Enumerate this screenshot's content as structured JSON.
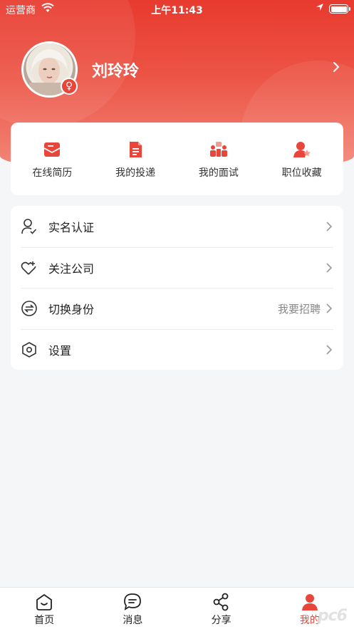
{
  "status_bar": {
    "carrier": "运营商",
    "time": "上午11:43"
  },
  "profile": {
    "name": "刘玲玲",
    "gender_symbol": "♀"
  },
  "quick_actions": [
    {
      "label": "在线简历",
      "icon": "resume-envelope-icon"
    },
    {
      "label": "我的投递",
      "icon": "document-icon"
    },
    {
      "label": "我的面试",
      "icon": "interview-icon"
    },
    {
      "label": "职位收藏",
      "icon": "favorite-job-icon"
    }
  ],
  "menu": [
    {
      "label": "实名认证",
      "icon": "user-verify-icon",
      "extra": ""
    },
    {
      "label": "关注公司",
      "icon": "heart-plus-icon",
      "extra": ""
    },
    {
      "label": "切换身份",
      "icon": "switch-icon",
      "extra": "我要招聘"
    },
    {
      "label": "设置",
      "icon": "settings-hexagon-icon",
      "extra": ""
    }
  ],
  "tabbar": [
    {
      "label": "首页",
      "icon": "home-icon"
    },
    {
      "label": "消息",
      "icon": "message-icon"
    },
    {
      "label": "分享",
      "icon": "share-icon"
    },
    {
      "label": "我的",
      "icon": "me-icon"
    }
  ],
  "colors": {
    "accent": "#e8463a",
    "header_top": "#e83a2e",
    "header_bottom": "#f28a7c"
  },
  "watermark": "pc6"
}
